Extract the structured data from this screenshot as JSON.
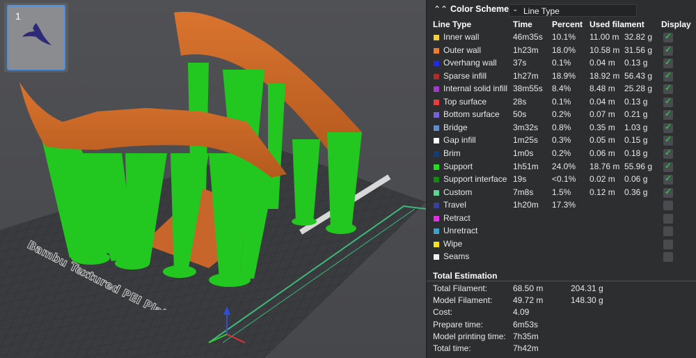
{
  "plate": {
    "number": "1"
  },
  "bed": {
    "label": "Bambu Textured PEI Plate"
  },
  "legend": {
    "scheme_title": "Color Scheme",
    "scheme_value": "Line Type",
    "headers": {
      "type": "Line Type",
      "time": "Time",
      "percent": "Percent",
      "filament": "Used filament",
      "display": "Display"
    },
    "rows": [
      {
        "label": "Inner wall",
        "time": "46m35s",
        "percent": "10.1%",
        "length": "11.00 m",
        "weight": "32.82 g",
        "color": "#f5cf3a",
        "display": true
      },
      {
        "label": "Outer wall",
        "time": "1h23m",
        "percent": "18.0%",
        "length": "10.58 m",
        "weight": "31.56 g",
        "color": "#f07d2a",
        "display": true
      },
      {
        "label": "Overhang wall",
        "time": "37s",
        "percent": "0.1%",
        "length": "0.04 m",
        "weight": "0.13 g",
        "color": "#1e2ae6",
        "display": true
      },
      {
        "label": "Sparse infill",
        "time": "1h27m",
        "percent": "18.9%",
        "length": "18.92 m",
        "weight": "56.43 g",
        "color": "#b02c2c",
        "display": true
      },
      {
        "label": "Internal solid infill",
        "time": "38m55s",
        "percent": "8.4%",
        "length": "8.48 m",
        "weight": "25.28 g",
        "color": "#a23bc9",
        "display": true
      },
      {
        "label": "Top surface",
        "time": "28s",
        "percent": "0.1%",
        "length": "0.04 m",
        "weight": "0.13 g",
        "color": "#ee3a3a",
        "display": true
      },
      {
        "label": "Bottom surface",
        "time": "50s",
        "percent": "0.2%",
        "length": "0.07 m",
        "weight": "0.21 g",
        "color": "#7a5fe0",
        "display": true
      },
      {
        "label": "Bridge",
        "time": "3m32s",
        "percent": "0.8%",
        "length": "0.35 m",
        "weight": "1.03 g",
        "color": "#5d8fcf",
        "display": true
      },
      {
        "label": "Gap infill",
        "time": "1m25s",
        "percent": "0.3%",
        "length": "0.05 m",
        "weight": "0.15 g",
        "color": "#ffffff",
        "display": true
      },
      {
        "label": "Brim",
        "time": "1m0s",
        "percent": "0.2%",
        "length": "0.06 m",
        "weight": "0.18 g",
        "color": "#143a78",
        "display": true
      },
      {
        "label": "Support",
        "time": "1h51m",
        "percent": "24.0%",
        "length": "18.76 m",
        "weight": "55.96 g",
        "color": "#1fe01f",
        "display": true
      },
      {
        "label": "Support interface",
        "time": "19s",
        "percent": "<0.1%",
        "length": "0.02 m",
        "weight": "0.06 g",
        "color": "#138a13",
        "display": true
      },
      {
        "label": "Custom",
        "time": "7m8s",
        "percent": "1.5%",
        "length": "0.12 m",
        "weight": "0.36 g",
        "color": "#5ed493",
        "display": true
      },
      {
        "label": "Travel",
        "time": "1h20m",
        "percent": "17.3%",
        "length": "",
        "weight": "",
        "color": "#3a3f9e",
        "display": false
      },
      {
        "label": "Retract",
        "time": "",
        "percent": "",
        "length": "",
        "weight": "",
        "color": "#e22fe2",
        "display": false
      },
      {
        "label": "Unretract",
        "time": "",
        "percent": "",
        "length": "",
        "weight": "",
        "color": "#3fa0c9",
        "display": false
      },
      {
        "label": "Wipe",
        "time": "",
        "percent": "",
        "length": "",
        "weight": "",
        "color": "#f5e21c",
        "display": false
      },
      {
        "label": "Seams",
        "time": "",
        "percent": "",
        "length": "",
        "weight": "",
        "color": "#eeeeee",
        "display": false
      }
    ],
    "total_title": "Total Estimation",
    "totals": [
      {
        "label": "Total Filament:",
        "value": "68.50 m",
        "value2": "204.31 g"
      },
      {
        "label": "Model Filament:",
        "value": "49.72 m",
        "value2": "148.30 g"
      },
      {
        "label": "Cost:",
        "value": "4.09",
        "value2": ""
      },
      {
        "label": "Prepare time:",
        "value": "6m53s",
        "value2": ""
      },
      {
        "label": "Model printing time:",
        "value": "7h35m",
        "value2": ""
      },
      {
        "label": "Total time:",
        "value": "7h42m",
        "value2": ""
      }
    ]
  }
}
